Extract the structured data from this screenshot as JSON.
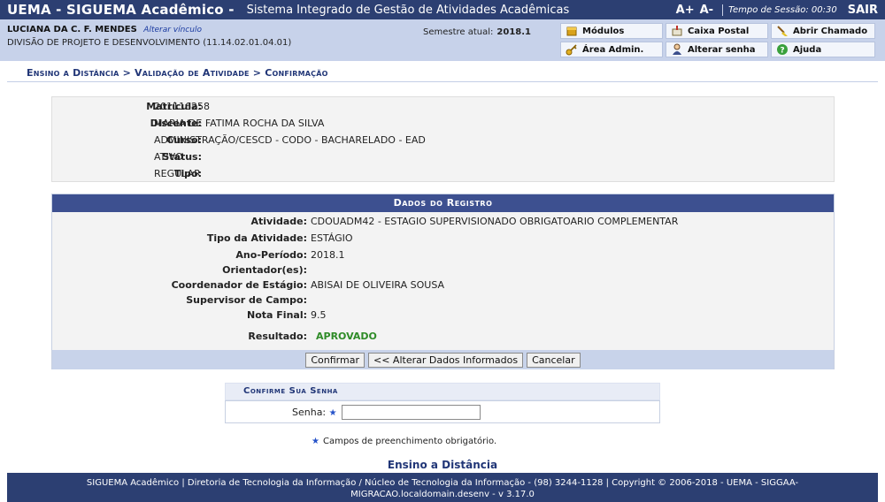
{
  "topbar": {
    "system_name": "UEMA - SIGUEMA Acadêmico -",
    "system_desc": "Sistema Integrado de Gestão de Atividades Acadêmicas",
    "font_increase": "A+",
    "font_decrease": "A-",
    "session_label": "Tempo de Sessão: 00:30",
    "logout": "SAIR"
  },
  "user": {
    "name": "LUCIANA DA C. F. MENDES",
    "change_link": "Alterar vínculo",
    "unit": "DIVISÃO DE PROJETO E DESENVOLVIMENTO (11.14.02.01.04.01)",
    "semester_label": "Semestre atual:",
    "semester_value": "2018.1"
  },
  "quick_links": {
    "modulos": "Módulos",
    "caixa_postal": "Caixa Postal",
    "abrir_chamado": "Abrir Chamado",
    "area_admin": "Área Admin.",
    "alterar_senha": "Alterar senha",
    "ajuda": "Ajuda"
  },
  "breadcrumb": {
    "p1": "Ensino a Distância",
    "sep1": ">",
    "p2": "Validação de Atividade",
    "sep2": ">",
    "p3": "Confirmação"
  },
  "discente": {
    "matricula_label": "Matrícula:",
    "matricula": "201116258",
    "discente_label": "Discente:",
    "discente": "MARIA DE FATIMA ROCHA DA SILVA",
    "curso_label": "Curso:",
    "curso": "ADMINISTRAÇÃO/CESCD - CODO - BACHARELADO - EAD",
    "status_label": "Status:",
    "status": "ATIVO",
    "tipo_label": "Tipo:",
    "tipo": "REGULAR"
  },
  "registro": {
    "caption": "Dados do Registro",
    "atividade_label": "Atividade:",
    "atividade": "CDOUADM42 - ESTAGIO SUPERVISIONADO OBRIGATOARIO COMPLEMENTAR",
    "tipo_label": "Tipo da Atividade:",
    "tipo": "ESTÁGIO",
    "ano_label": "Ano-Período:",
    "ano": "2018.1",
    "orientador_label": "Orientador(es):",
    "orientador": "",
    "coordenador_label": "Coordenador de Estágio:",
    "coordenador": "ABISAI DE OLIVEIRA SOUSA",
    "supervisor_label": "Supervisor de Campo:",
    "supervisor": "",
    "nota_label": "Nota Final:",
    "nota": "9.5",
    "resultado_label": "Resultado:",
    "resultado": "APROVADO",
    "btn_confirmar": "Confirmar",
    "btn_alterar": "<< Alterar Dados Informados",
    "btn_cancelar": "Cancelar"
  },
  "confirm": {
    "caption": "Confirme Sua Senha",
    "senha_label": "Senha:",
    "required_mark": "★",
    "senha_value": ""
  },
  "required_note": "Campos de preenchimento obrigatório.",
  "module_link": "Ensino a Distância",
  "footer": "SIGUEMA Acadêmico | Diretoria de Tecnologia da Informação / Núcleo de Tecnologia da Informação - (98) 3244-1128 | Copyright © 2006-2018 - UEMA - SIGGAA-MIGRACAO.localdomain.desenv - v 3.17.0",
  "colors": {
    "header_blue": "#2c3f72",
    "info_bar": "#c7d2ea",
    "approved_green": "#2e8b27"
  }
}
